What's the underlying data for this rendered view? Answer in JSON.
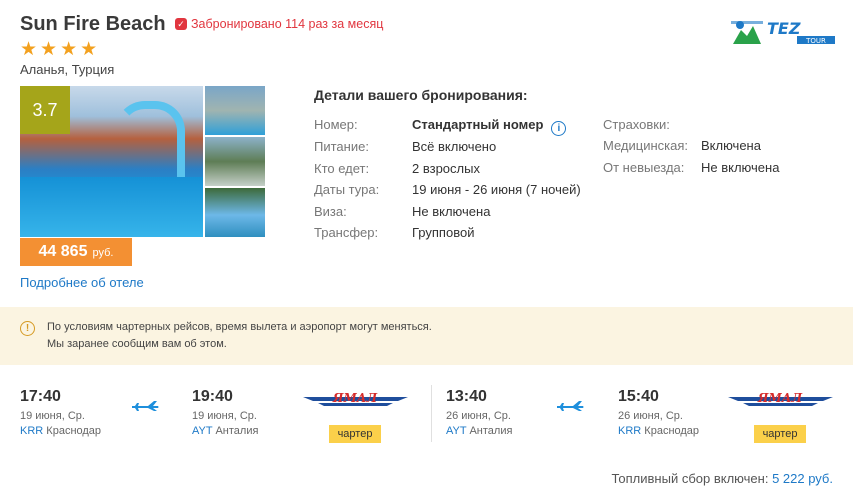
{
  "hotel": {
    "name": "Sun Fire Beach",
    "booked_text": "Забронировано 114 раз за месяц",
    "stars": 4,
    "location": "Аланья, Турция",
    "rating": "3.7",
    "price": "44 865",
    "currency": "руб.",
    "more_link": "Подробнее об отеле"
  },
  "logo": {
    "text": "TEZ",
    "subtext": "TOUR"
  },
  "booking": {
    "title": "Детали вашего бронирования:",
    "left": [
      {
        "label": "Номер:",
        "value": "Стандартный номер"
      },
      {
        "label": "Питание:",
        "value": "Всё включено"
      },
      {
        "label": "Кто едет:",
        "value": "2 взрослых"
      },
      {
        "label": "Даты тура:",
        "value": "19 июня - 26 июня (7 ночей)"
      },
      {
        "label": "Виза:",
        "value": "Не включена"
      },
      {
        "label": "Трансфер:",
        "value": "Групповой"
      }
    ],
    "right": [
      {
        "label": "Страховки:",
        "value": ""
      },
      {
        "label": "Медицинская:",
        "value": "Включена"
      },
      {
        "label": "От невыезда:",
        "value": "Не включена"
      }
    ]
  },
  "notice": {
    "line1": "По условиям чартерных рейсов, время вылета и аэропорт могут меняться.",
    "line2": "Мы заранее сообщим вам об этом."
  },
  "flights": [
    {
      "dep": {
        "time": "17:40",
        "date": "19 июня, Ср.",
        "code": "KRR",
        "city": "Краснодар"
      },
      "arr": {
        "time": "19:40",
        "date": "19 июня, Ср.",
        "code": "AYT",
        "city": "Анталия"
      },
      "airline": "ЯМАЛ",
      "type": "чартер"
    },
    {
      "dep": {
        "time": "13:40",
        "date": "26 июня, Ср.",
        "code": "AYT",
        "city": "Анталия"
      },
      "arr": {
        "time": "15:40",
        "date": "26 июня, Ср.",
        "code": "KRR",
        "city": "Краснодар"
      },
      "airline": "ЯМАЛ",
      "type": "чартер"
    }
  ],
  "fuel": {
    "label": "Топливный сбор включен:",
    "amount": "5 222 руб."
  },
  "colors": {
    "accent": "#1e79c7",
    "price": "#f39033",
    "rating": "#a5a51a",
    "star": "#f3a11f",
    "alert": "#e1363f",
    "charter": "#fbd04a",
    "notice_bg": "#fbf4e1"
  }
}
